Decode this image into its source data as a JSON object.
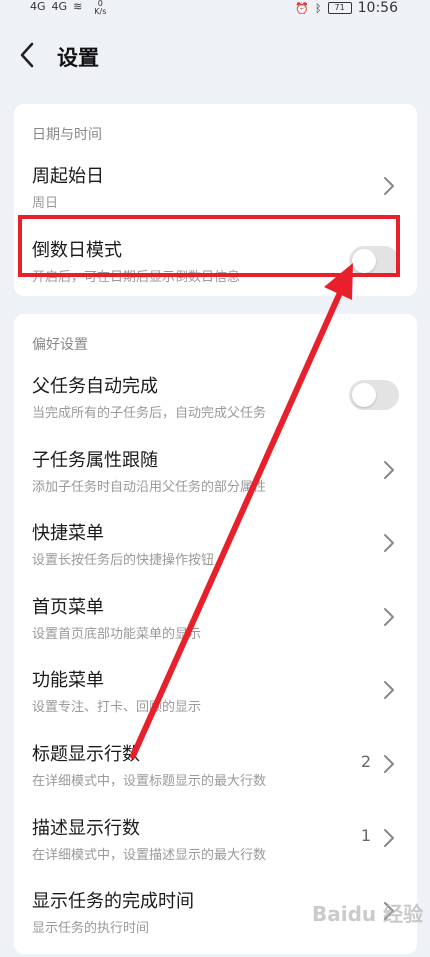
{
  "status_bar": {
    "carrier1": "4G",
    "carrier2": "4G",
    "net_speed_value": "0",
    "net_speed_unit": "K/s",
    "battery": "71",
    "time": "10:56"
  },
  "header": {
    "title": "设置"
  },
  "date_time_section": {
    "title": "日期与时间",
    "items": [
      {
        "title": "周起始日",
        "subtitle": "周日"
      },
      {
        "title": "倒数日模式",
        "subtitle": "开启后，可在日期后显示倒数日信息",
        "toggle_on": false
      }
    ]
  },
  "preferences_section": {
    "title": "偏好设置",
    "items": [
      {
        "title": "父任务自动完成",
        "subtitle": "当完成所有的子任务后，自动完成父任务",
        "toggle_on": false
      },
      {
        "title": "子任务属性跟随",
        "subtitle": "添加子任务时自动沿用父任务的部分属性"
      },
      {
        "title": "快捷菜单",
        "subtitle": "设置长按任务后的快捷操作按钮"
      },
      {
        "title": "首页菜单",
        "subtitle": "设置首页底部功能菜单的显示"
      },
      {
        "title": "功能菜单",
        "subtitle": "设置专注、打卡、回顾的显示"
      },
      {
        "title": "标题显示行数",
        "subtitle": "在详细模式中，设置标题显示的最大行数",
        "value": "2"
      },
      {
        "title": "描述显示行数",
        "subtitle": "在详细模式中，设置描述显示的最大行数",
        "value": "1"
      },
      {
        "title": "显示任务的完成时间",
        "subtitle": "显示任务的执行时间"
      }
    ]
  },
  "watermark": "Baidu 经验"
}
